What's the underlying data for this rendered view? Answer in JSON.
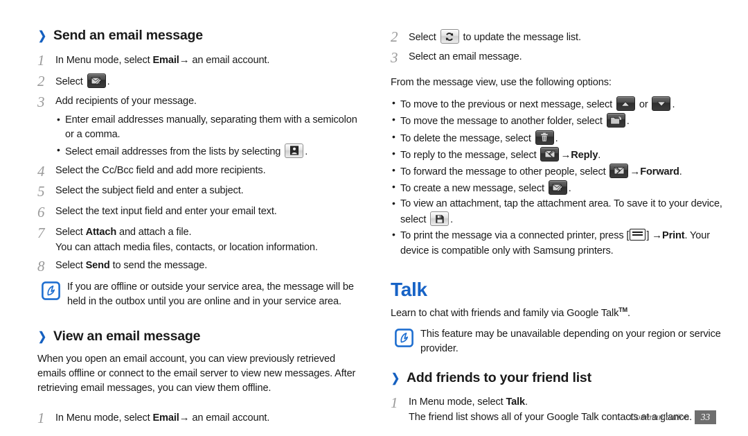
{
  "footer": {
    "section_label": "Communication",
    "page_number": "33"
  },
  "colors": {
    "heading_blue": "#1763c6",
    "chevron_blue": "#1560c0",
    "note_blue": "#1f6fd0",
    "step_number_gray": "#9a9a9a",
    "footer_gray": "#6e6e6e",
    "body_text": "#1a1a1a"
  },
  "left_column": {
    "section1": {
      "chevron": "❯",
      "heading": "Send an email message",
      "steps": [
        {
          "num": "1",
          "text_before": "In Menu mode, select ",
          "bold1": "Email",
          "arrow": "→",
          "text_after": " an email account."
        },
        {
          "num": "2",
          "text_before": "Select ",
          "icon": "compose-email-icon",
          "text_after": "."
        },
        {
          "num": "3",
          "text_before": "Add recipients of your message.",
          "bullets": [
            {
              "text": "Enter email addresses manually, separating them with a semicolon or a comma."
            },
            {
              "text_before": "Select email addresses from the lists by selecting ",
              "icon": "contacts-icon",
              "text_after": "."
            }
          ]
        },
        {
          "num": "4",
          "text_before": "Select the Cc/Bcc field and add more recipients."
        },
        {
          "num": "5",
          "text_before": "Select the subject field and enter a subject."
        },
        {
          "num": "6",
          "text_before": "Select the text input field and enter your email text."
        },
        {
          "num": "7",
          "text_before": "Select ",
          "bold1": "Attach",
          "text_after": " and attach a file.",
          "sub": "You can attach media files, contacts, or location information."
        },
        {
          "num": "8",
          "text_before": "Select ",
          "bold1": "Send",
          "text_after": " to send the message."
        }
      ],
      "note": {
        "icon": "note-icon",
        "text": "If you are offline or outside your service area, the message will be held in the outbox until you are online and in your service area."
      }
    },
    "section2": {
      "chevron": "❯",
      "heading": "View an email message",
      "intro": "When you open an email account, you can view previously retrieved emails offline or connect to the email server to view new messages. After retrieving email messages, you can view them offline.",
      "steps": [
        {
          "num": "1",
          "text_before": "In Menu mode, select ",
          "bold1": "Email",
          "arrow": "→",
          "text_after": " an email account."
        }
      ]
    }
  },
  "right_column": {
    "continued_steps": [
      {
        "num": "2",
        "text_before": "Select ",
        "icon": "refresh-icon",
        "text_after": " to update the message list."
      },
      {
        "num": "3",
        "text_before": "Select an email message."
      }
    ],
    "options_intro": "From the message view, use the following options:",
    "options": [
      {
        "text_before": "To move to the previous or next message, select ",
        "icon": "arrow-up-icon",
        "text_middle": " or ",
        "icon2": "arrow-down-icon",
        "text_after": "."
      },
      {
        "text_before": "To move the message to another folder, select ",
        "icon": "move-folder-icon",
        "text_after": "."
      },
      {
        "text_before": "To delete the message, select ",
        "icon": "trash-icon",
        "text_after": "."
      },
      {
        "text_before": "To reply to the message, select ",
        "icon": "reply-icon",
        "arrow": "→",
        "bold1": "Reply",
        "text_after": "."
      },
      {
        "text_before": "To forward the message to other people, select ",
        "icon": "forward-icon",
        "arrow": "→",
        "bold1": "Forward",
        "text_after": "."
      },
      {
        "text_before": "To create a new message, select ",
        "icon": "compose-email-icon",
        "text_after": "."
      },
      {
        "text_before": "To view an attachment, tap the attachment area. To save it to your device, select ",
        "icon": "save-icon",
        "text_after": "."
      },
      {
        "text_before": "To print the message via a connected printer, press [",
        "icon": "menu-key-icon",
        "text_bracket": "] ",
        "arrow": "→",
        "bold1": "Print",
        "text_after": ". Your device is compatible only with Samsung printers."
      }
    ],
    "talk_section": {
      "heading": "Talk",
      "intro_before": "Learn to chat with friends and family via Google Talk",
      "tm": "TM",
      "intro_after": ".",
      "note": {
        "icon": "note-icon",
        "text": "This feature may be unavailable depending on your region or service provider."
      },
      "subsection": {
        "chevron": "❯",
        "heading": "Add friends to your friend list",
        "steps": [
          {
            "num": "1",
            "text_before": "In Menu mode, select ",
            "bold1": "Talk",
            "text_after": ".",
            "sub": "The friend list shows all of your Google Talk contacts at a glance."
          }
        ]
      }
    }
  }
}
